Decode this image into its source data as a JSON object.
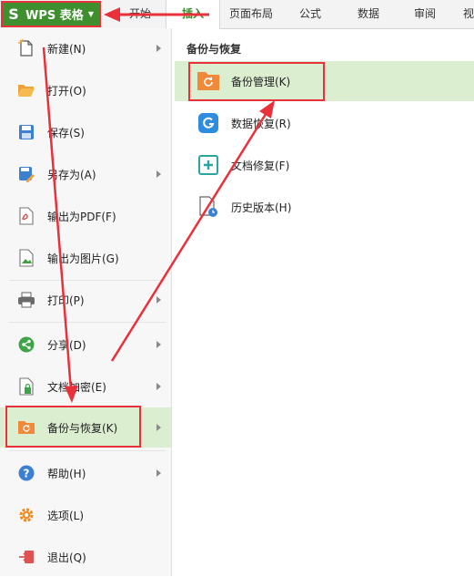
{
  "app": {
    "brand": "WPS 表格",
    "brand_icon": "wps-s-logo-icon",
    "accent_color": "#3f8f2f",
    "highlight_color": "#e8313a",
    "selected_bg": "#dbeed0"
  },
  "ribbon": {
    "tabs": [
      {
        "label": "开始",
        "active": false
      },
      {
        "label": "插入",
        "active": true
      },
      {
        "label": "页面布局",
        "active": false
      },
      {
        "label": "公式",
        "active": false
      },
      {
        "label": "数据",
        "active": false
      },
      {
        "label": "审阅",
        "active": false
      },
      {
        "label": "视",
        "active": false
      }
    ]
  },
  "file_menu": {
    "items": [
      {
        "label": "新建(N)",
        "icon": "new-file-icon",
        "submenu": true
      },
      {
        "label": "打开(O)",
        "icon": "open-folder-icon",
        "submenu": false
      },
      {
        "label": "保存(S)",
        "icon": "save-icon",
        "submenu": false
      },
      {
        "label": "另存为(A)",
        "icon": "save-as-icon",
        "submenu": true
      },
      {
        "label": "输出为PDF(F)",
        "icon": "export-pdf-icon",
        "submenu": false
      },
      {
        "label": "输出为图片(G)",
        "icon": "export-image-icon",
        "submenu": false
      },
      {
        "label": "打印(P)",
        "icon": "printer-icon",
        "submenu": true
      },
      {
        "label": "分享(D)",
        "icon": "share-icon",
        "submenu": true
      },
      {
        "label": "文档加密(E)",
        "icon": "encrypt-document-icon",
        "submenu": true
      },
      {
        "label": "备份与恢复(K)",
        "icon": "backup-restore-icon",
        "submenu": true,
        "selected": true
      },
      {
        "label": "帮助(H)",
        "icon": "help-icon",
        "submenu": true
      },
      {
        "label": "选项(L)",
        "icon": "settings-gear-icon",
        "submenu": false
      },
      {
        "label": "退出(Q)",
        "icon": "exit-icon",
        "submenu": false
      }
    ]
  },
  "submenu": {
    "title": "备份与恢复",
    "items": [
      {
        "label": "备份管理(K)",
        "icon": "backup-management-icon",
        "selected": true
      },
      {
        "label": "数据恢复(R)",
        "icon": "data-recovery-icon"
      },
      {
        "label": "文档修复(F)",
        "icon": "document-repair-icon"
      },
      {
        "label": "历史版本(H)",
        "icon": "history-version-icon"
      }
    ]
  }
}
